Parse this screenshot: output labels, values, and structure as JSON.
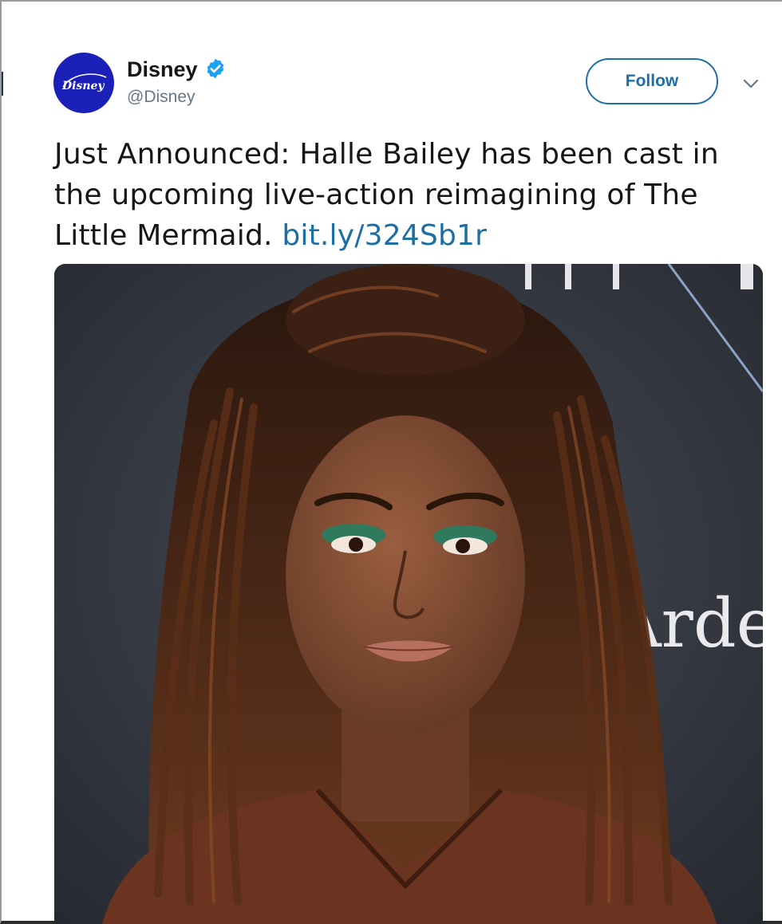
{
  "tweet": {
    "author": {
      "display_name": "Disney",
      "handle": "@Disney",
      "verified": true,
      "avatar_logo_text": "Disney",
      "avatar_color": "#1a20b8"
    },
    "follow_label": "Follow",
    "text_before_link": "Just Announced: Halle Bailey has been cast in the upcoming live-action reimagining of The Little Mermaid. ",
    "link_text": "bit.ly/324Sb1r",
    "media": {
      "backdrop_text": "Arden"
    },
    "colors": {
      "link": "#1b6fa4",
      "follow_border": "#1d6fa5",
      "verified_badge": "#1da1f2",
      "text": "#14171a",
      "muted": "#657786"
    }
  }
}
